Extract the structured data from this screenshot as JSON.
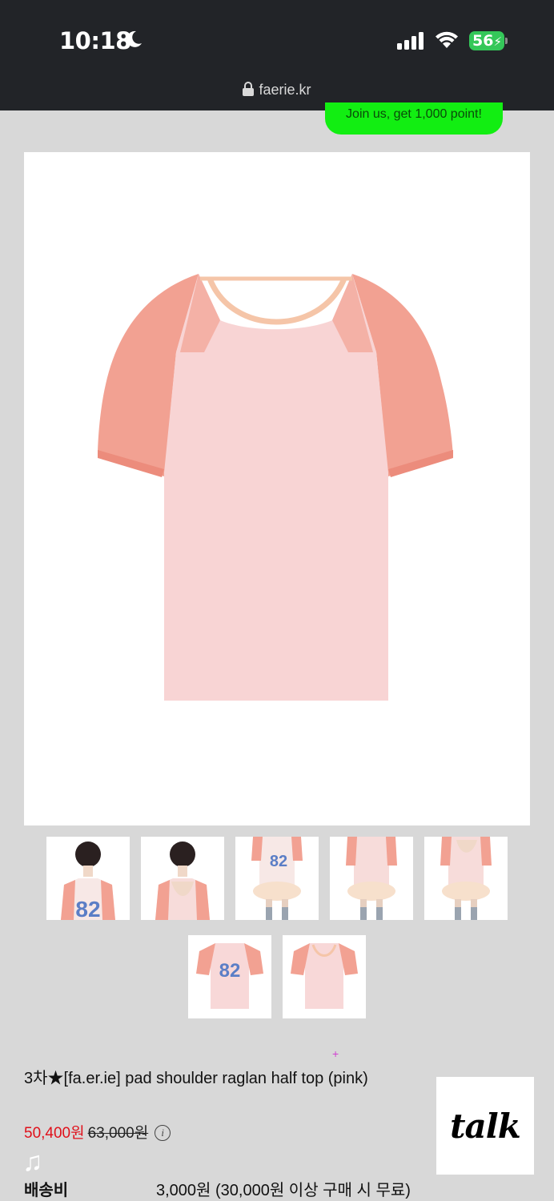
{
  "status": {
    "time": "10:18",
    "battery": "56",
    "url": "faerie.kr"
  },
  "banner": {
    "join_text": "Join us, get 1,000 point!"
  },
  "product": {
    "title": "3차★[fa.er.ie] pad shoulder raglan half top (pink)",
    "price": "50,400원",
    "original_price": "63,000원",
    "shipping_label": "배송비",
    "shipping_value": "3,000원 (30,000원 이상 구매 시 무료)"
  },
  "thumbnails": [
    {
      "name": "model-front"
    },
    {
      "name": "model-back"
    },
    {
      "name": "model-skirt-front"
    },
    {
      "name": "model-skirt-back"
    },
    {
      "name": "model-skirt-side"
    },
    {
      "name": "shirt-front"
    },
    {
      "name": "shirt-back"
    }
  ],
  "chat": {
    "label": "talk"
  },
  "colors": {
    "status_bg": "#222428",
    "page_bg": "#d8d8d8",
    "join_green": "#12ee12",
    "price_red": "#e0101a",
    "shirt_pink": "#f6cece",
    "sleeve_coral": "#f2998a"
  },
  "icons": [
    "moon-icon",
    "signal-icon",
    "wifi-icon",
    "battery-icon",
    "lock-icon",
    "info-icon",
    "music-note-icon"
  ]
}
